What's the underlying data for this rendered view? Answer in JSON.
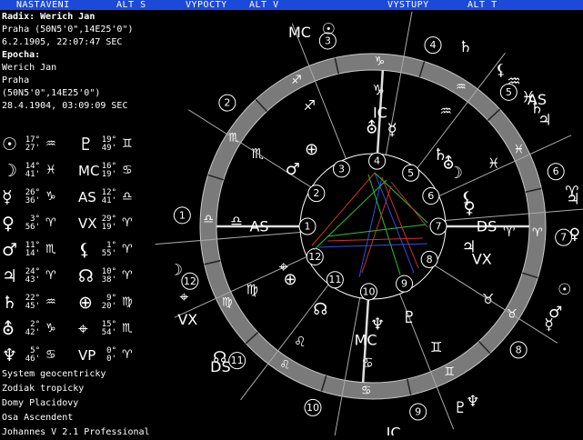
{
  "menu": {
    "items": [
      "NASTAVENI",
      "ALT S",
      "VYPOCTY",
      "ALT V",
      "VYSTUPY",
      "ALT T"
    ]
  },
  "radix": {
    "header": "Radix: Werich Jan",
    "place": "Praha (50N5'0\",14E25'0\")",
    "datetime": "6.2.1905, 22:07:47 SEC"
  },
  "epocha": {
    "header": "Epocha:",
    "name": "Werich Jan",
    "place": "Praha",
    "coords": "(50N5'0\",14E25'0\")",
    "datetime": "28.4.1904, 03:09:09 SEC"
  },
  "planets_left": [
    {
      "glyph": "☉",
      "deg": "17°",
      "min": "27'",
      "sign": "♒"
    },
    {
      "glyph": "☽",
      "deg": "14°",
      "min": "41'",
      "sign": "♓"
    },
    {
      "glyph": "☿",
      "deg": "26°",
      "min": "36'",
      "sign": "♑"
    },
    {
      "glyph": "♀",
      "deg": "3°",
      "min": "56'",
      "sign": "♈"
    },
    {
      "glyph": "♂",
      "deg": "11°",
      "min": "14'",
      "sign": "♏"
    },
    {
      "glyph": "♃",
      "deg": "24°",
      "min": "43'",
      "sign": "♈"
    },
    {
      "glyph": "♄",
      "deg": "22°",
      "min": "45'",
      "sign": "♒"
    },
    {
      "glyph": "⛢",
      "deg": "2°",
      "min": "42'",
      "sign": "♑"
    },
    {
      "glyph": "♆",
      "deg": "5°",
      "min": "46'",
      "sign": "♋"
    }
  ],
  "planets_right": [
    {
      "glyph": "♇",
      "deg": "19°",
      "min": "49'",
      "sign": "♊"
    },
    {
      "glyph": "MC",
      "deg": "16°",
      "min": "19'",
      "sign": "♋"
    },
    {
      "glyph": "AS",
      "deg": "12°",
      "min": "41'",
      "sign": "♎"
    },
    {
      "glyph": "VX",
      "deg": "29°",
      "min": "19'",
      "sign": "♈"
    },
    {
      "glyph": "⚸",
      "deg": "1°",
      "min": "55'",
      "sign": "♈"
    },
    {
      "glyph": "☊",
      "deg": "10°",
      "min": "38'",
      "sign": "♈"
    },
    {
      "glyph": "⊕",
      "deg": "9°",
      "min": "20'",
      "sign": "♍"
    },
    {
      "glyph": "⌖",
      "deg": "15°",
      "min": "54'",
      "sign": "♏"
    },
    {
      "glyph": "VP",
      "deg": "0°",
      "min": "0'",
      "sign": "♈"
    }
  ],
  "footer": {
    "system": "System geocentricky",
    "zodiac": "Zodiak tropicky",
    "houses": "Domy Placidovy",
    "axis": "Osa Ascendent",
    "app": "Johannes V 2.1 Professional"
  },
  "chart_data": {
    "type": "other",
    "ascendant_longitude": 192.68,
    "zodiac_signs": [
      "♈",
      "♉",
      "♊",
      "♋",
      "♌",
      "♍",
      "♎",
      "♏",
      "♐",
      "♑",
      "♒",
      "♓"
    ],
    "outer_house_numbers": [
      "1",
      "2",
      "3",
      "4",
      "5",
      "6",
      "7",
      "8",
      "9",
      "10",
      "11",
      "12"
    ],
    "outer_house_cusps": [
      188,
      225,
      261,
      293,
      320,
      348,
      8,
      45,
      81,
      113,
      140,
      168
    ],
    "inner_house_numbers": [
      "1",
      "2",
      "3",
      "4",
      "5",
      "6",
      "7",
      "8",
      "9",
      "10",
      "11",
      "12"
    ],
    "inner_house_cusps": [
      192.7,
      223,
      254,
      286.3,
      318,
      345,
      12.7,
      43,
      74,
      106.3,
      138,
      165
    ],
    "inner_axis_labels": [
      {
        "label": "AS",
        "lon": 192.7
      },
      {
        "label": "DS",
        "lon": 12.7
      },
      {
        "label": "MC",
        "lon": 106.3
      },
      {
        "label": "IC",
        "lon": 286.3
      },
      {
        "label": "VX",
        "lon": 29.3
      }
    ],
    "outer_axis_labels": [
      {
        "label": "DS",
        "lon": 150
      },
      {
        "label": "VX",
        "lon": 166
      },
      {
        "label": "AS",
        "lon": 335
      },
      {
        "label": "IC",
        "lon": 97
      },
      {
        "label": "MC",
        "lon": 262
      }
    ],
    "inner_glyphs": [
      {
        "g": "♆",
        "lon": 100
      },
      {
        "g": "♇",
        "lon": 81
      },
      {
        "g": "☊",
        "lon": 135
      },
      {
        "g": "⊕",
        "lon": 160
      },
      {
        "g": "⌖",
        "lon": 168
      },
      {
        "g": "♂",
        "lon": 228
      },
      {
        "g": "⊕",
        "lon": 244
      },
      {
        "g": "⛢",
        "lon": 282
      },
      {
        "g": "☿",
        "lon": 294
      },
      {
        "g": "♄",
        "lon": 326
      },
      {
        "g": "⛢",
        "lon": 333
      },
      {
        "g": "♀",
        "lon": 2
      },
      {
        "g": "⚸",
        "lon": 356
      },
      {
        "g": "♃",
        "lon": 25
      },
      {
        "g": "☽",
        "lon": 340
      }
    ],
    "outer_glyphs": [
      {
        "g": "♆",
        "lon": 73
      },
      {
        "g": "♇",
        "lon": 77
      },
      {
        "g": "☿",
        "lon": 42
      },
      {
        "g": "♂",
        "lon": 38
      },
      {
        "g": "☉",
        "lon": 31
      },
      {
        "g": "♀",
        "lon": 15
      },
      {
        "g": "♃",
        "lon": 5
      },
      {
        "g": "♓",
        "lon": 333
      },
      {
        "g": "♈",
        "lon": 3
      },
      {
        "g": "☊",
        "lon": 152
      },
      {
        "g": "⌖",
        "lon": 172
      },
      {
        "g": "☽",
        "lon": 180
      },
      {
        "g": "♃",
        "lon": 341
      },
      {
        "g": "♄",
        "lon": 337
      },
      {
        "g": "☉",
        "lon": 270
      },
      {
        "g": "♒",
        "lon": 327
      },
      {
        "g": "♄",
        "lon": 310
      },
      {
        "g": "⚸",
        "lon": 322
      }
    ]
  }
}
